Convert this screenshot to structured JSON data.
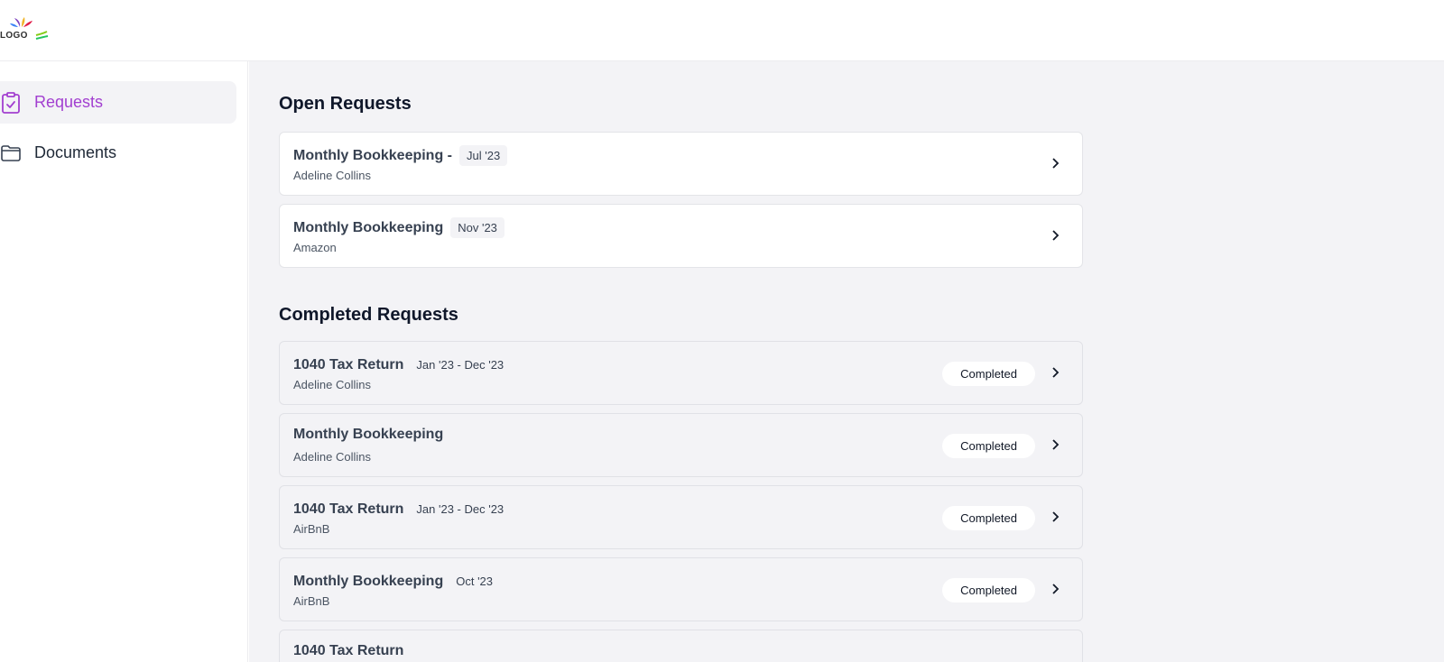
{
  "app": {
    "logo_text": "LOGO"
  },
  "sidebar": {
    "items": [
      {
        "label": "Requests",
        "icon": "clipboard-check-icon",
        "active": true
      },
      {
        "label": "Documents",
        "icon": "folder-icon",
        "active": false
      }
    ]
  },
  "main": {
    "open_title": "Open Requests",
    "completed_title": "Completed Requests",
    "open_requests": [
      {
        "title": "Monthly Bookkeeping -",
        "period": "Jul '23",
        "client": "Adeline Collins"
      },
      {
        "title": "Monthly Bookkeeping",
        "period": "Nov '23",
        "client": "Amazon"
      }
    ],
    "completed_requests": [
      {
        "title": "1040 Tax Return",
        "period": "Jan '23 - Dec '23",
        "client": "Adeline Collins",
        "status": "Completed"
      },
      {
        "title": "Monthly Bookkeeping",
        "period": "",
        "client": "Adeline Collins",
        "status": "Completed"
      },
      {
        "title": "1040 Tax Return",
        "period": "Jan '23 - Dec '23",
        "client": "AirBnB",
        "status": "Completed"
      },
      {
        "title": "Monthly Bookkeeping",
        "period": "Oct '23",
        "client": "AirBnB",
        "status": "Completed"
      },
      {
        "title": "1040 Tax Return",
        "period": "",
        "client": "",
        "status": ""
      }
    ]
  },
  "colors": {
    "accent": "#a23fd0",
    "background": "#f3f3f6"
  }
}
